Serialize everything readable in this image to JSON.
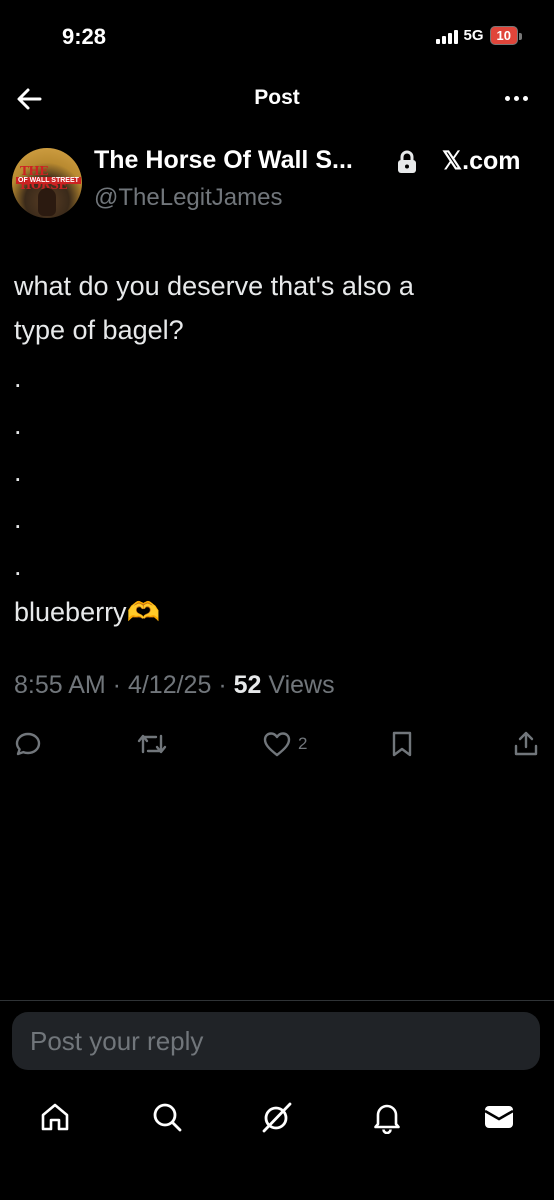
{
  "status_bar": {
    "time": "9:28",
    "network": "5G",
    "battery": "10"
  },
  "header": {
    "title": "Post"
  },
  "author": {
    "display_name": "The Horse Of Wall S...",
    "handle": "@TheLegitJames",
    "badge_label": "𝕏.com",
    "avatar_text_1": "THE HORSE",
    "avatar_text_2": "OF WALL STREET"
  },
  "post": {
    "line1": "what do you deserve that's also a",
    "line2": "type of bagel?",
    "dots": [
      ".",
      ".",
      ".",
      ".",
      "."
    ],
    "line_final": "blueberry🫶",
    "time": "8:55 AM",
    "date": "4/12/25",
    "views_count": "52",
    "views_label": "Views"
  },
  "actions": {
    "likes": "2"
  },
  "reply": {
    "placeholder": "Post your reply"
  },
  "icons": [
    "back-arrow-icon",
    "more-icon",
    "lock-icon",
    "reply-icon",
    "retweet-icon",
    "heart-icon",
    "bookmark-icon",
    "share-icon",
    "home-icon",
    "search-icon",
    "grok-icon",
    "bell-icon",
    "mail-icon"
  ]
}
